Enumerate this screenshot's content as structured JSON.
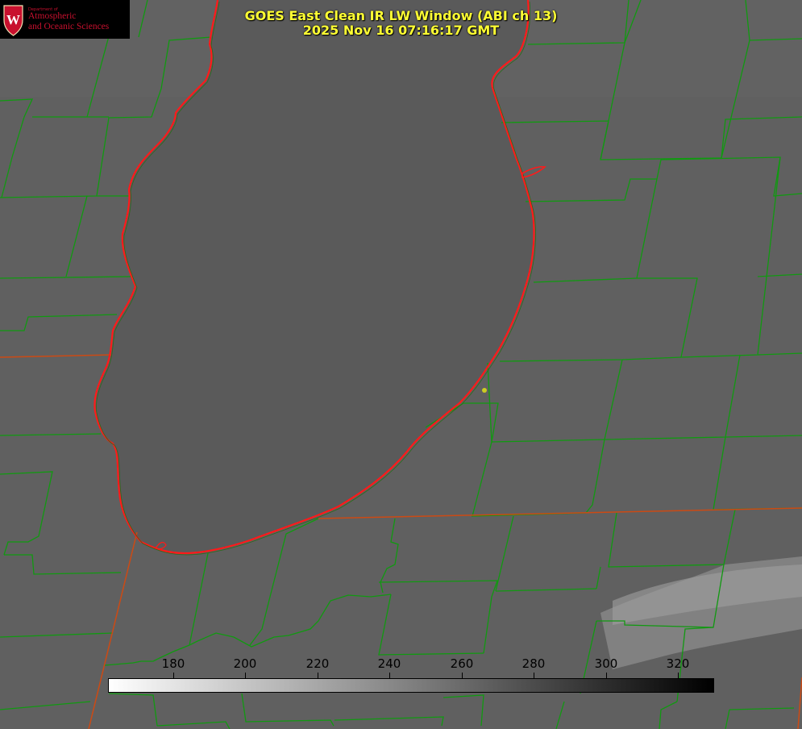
{
  "title": {
    "line1": "GOES East Clean IR LW Window (ABI ch 13)",
    "line2": "2025 Nov 16 07:16:17 GMT"
  },
  "logo": {
    "dept": "Department of",
    "line1": "Atmospheric",
    "line2": "and Oceanic Sciences",
    "seal_letter": "W",
    "icon": "uw-crest-icon"
  },
  "colorbar": {
    "ticks": [
      "180",
      "200",
      "220",
      "240",
      "260",
      "280",
      "300",
      "320"
    ],
    "gradient_start": "#ffffff",
    "gradient_end": "#000000"
  },
  "colors": {
    "county_lines": "#119911",
    "state_lines": "#cc4a14",
    "coastline": "#ff1a1a",
    "title_text": "#ffff33",
    "marker": "#cccc22"
  }
}
